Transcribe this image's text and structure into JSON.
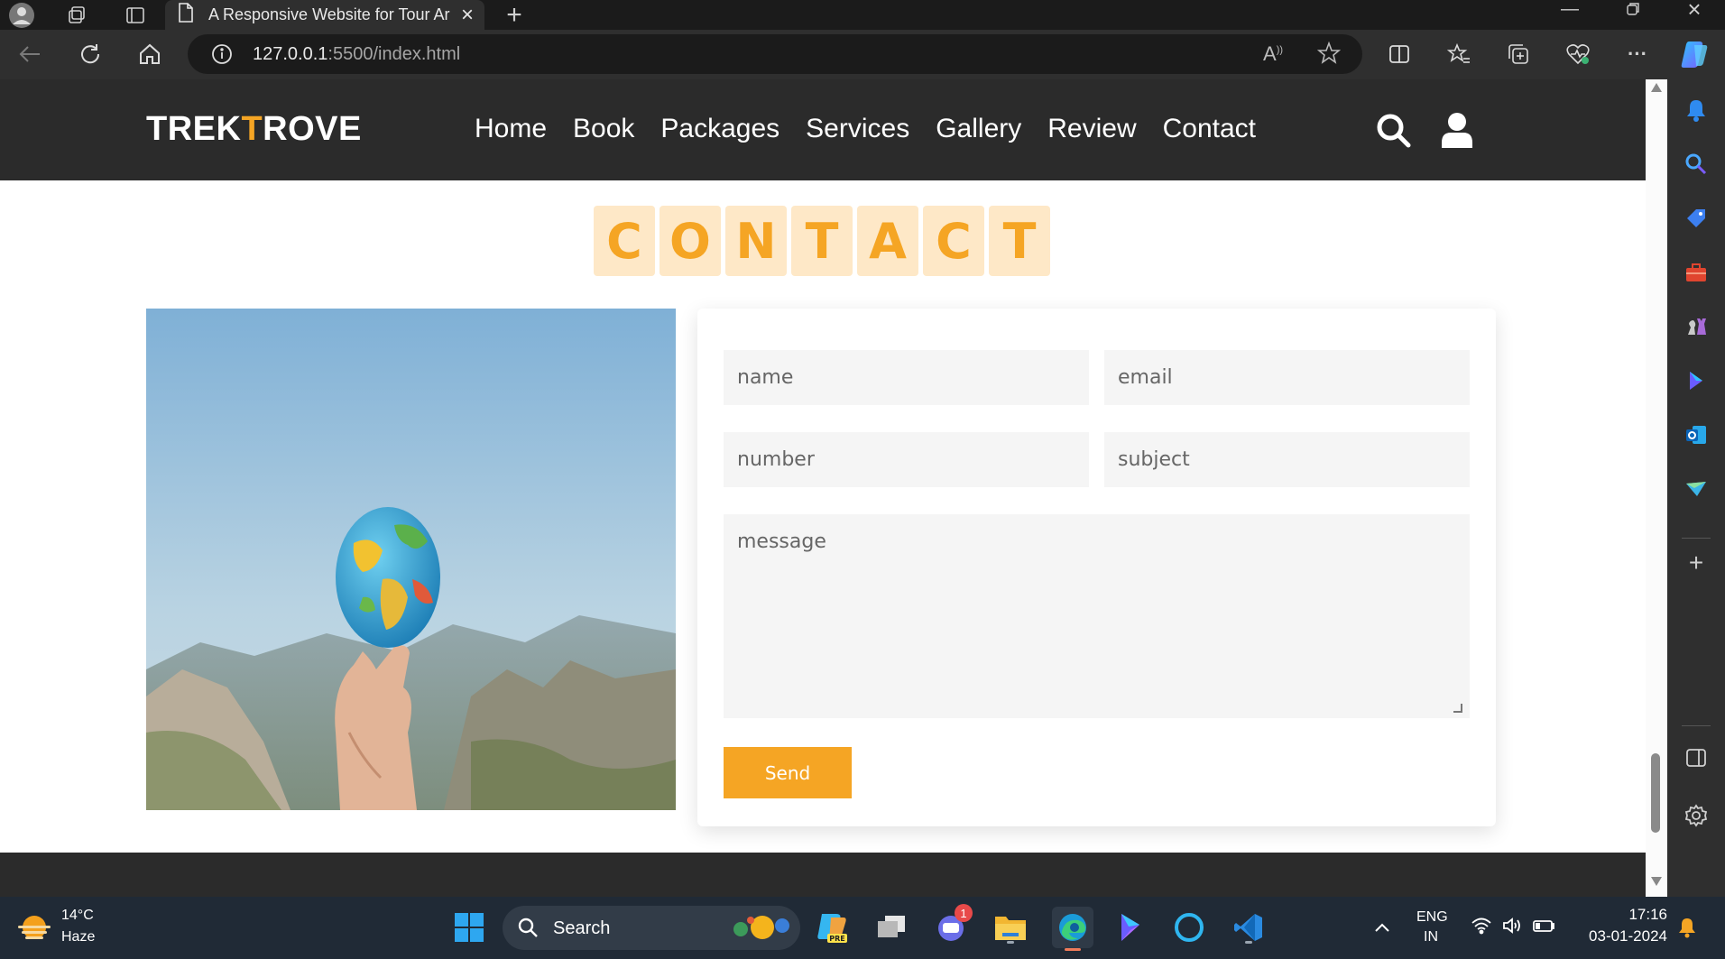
{
  "browser": {
    "tab_title": "A Responsive Website for Tour Ar",
    "url_host": "127.0.0.1",
    "url_path": ":5500/index.html"
  },
  "site": {
    "logo_part1": "TREK",
    "logo_accent": "T",
    "logo_part2": "ROVE",
    "nav": [
      "Home",
      "Book",
      "Packages",
      "Services",
      "Gallery",
      "Review",
      "Contact"
    ],
    "accent_color": "#f5a524"
  },
  "contact": {
    "heading_letters": [
      "C",
      "O",
      "N",
      "T",
      "A",
      "C",
      "T"
    ],
    "form": {
      "name_placeholder": "name",
      "email_placeholder": "email",
      "number_placeholder": "number",
      "subject_placeholder": "subject",
      "message_placeholder": "message",
      "send_label": "Send"
    }
  },
  "taskbar": {
    "weather_temp": "14°C",
    "weather_desc": "Haze",
    "search_label": "Search",
    "teams_badge": "1",
    "lang_top": "ENG",
    "lang_bottom": "IN",
    "time": "17:16",
    "date": "03-01-2024"
  }
}
